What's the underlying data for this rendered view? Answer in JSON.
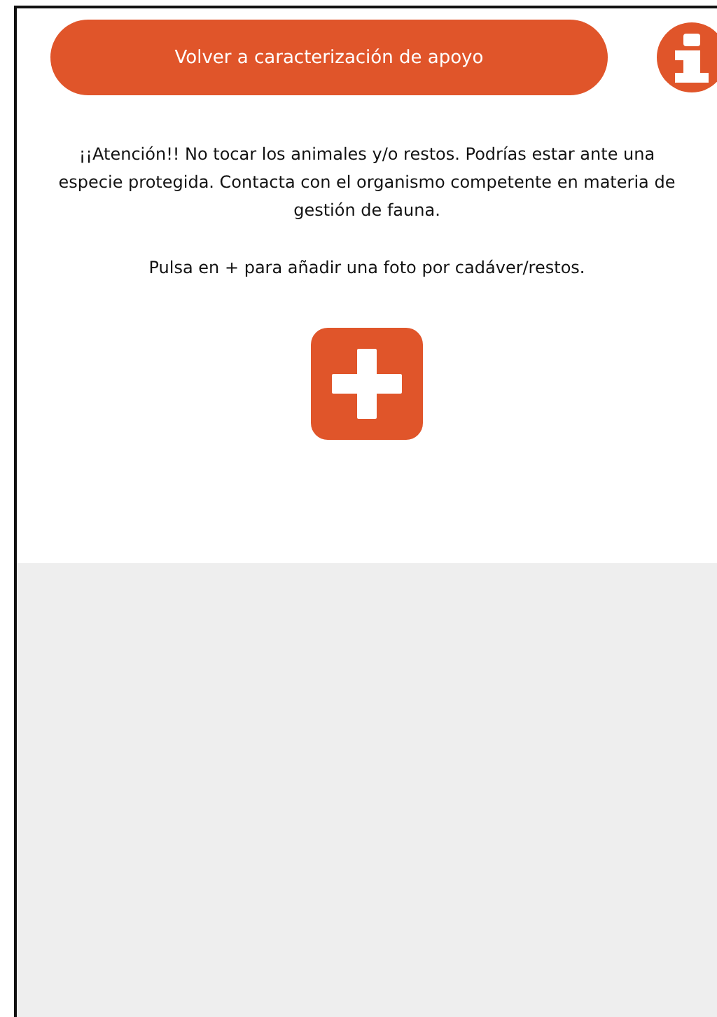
{
  "back_button": {
    "label": "Volver a caracterización de apoyo"
  },
  "warning": "¡¡Atención!! No tocar los animales y/o restos. Podrías estar ante una especie protegida. Contacta con el organismo competente en materia de gestión de fauna.",
  "instruction": "Pulsa en + para añadir una foto por cadáver/restos."
}
